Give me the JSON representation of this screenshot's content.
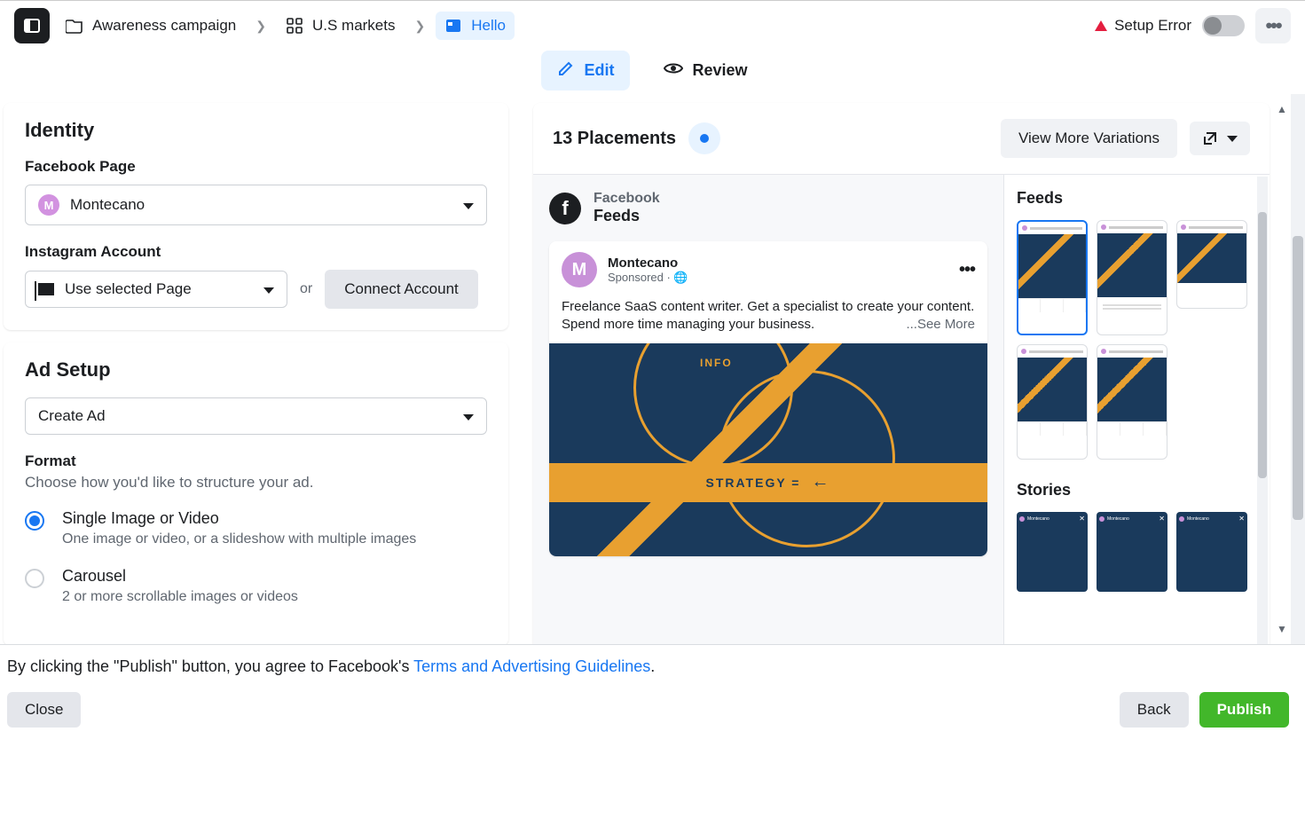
{
  "breadcrumb": {
    "campaign": "Awareness campaign",
    "adset": "U.S markets",
    "ad": "Hello"
  },
  "status": {
    "label": "Setup Error"
  },
  "tabs": {
    "edit": "Edit",
    "review": "Review"
  },
  "identity": {
    "heading": "Identity",
    "fb_label": "Facebook Page",
    "fb_value": "Montecano",
    "ig_label": "Instagram Account",
    "ig_value": "Use selected Page",
    "or": "or",
    "connect": "Connect Account"
  },
  "adsetup": {
    "heading": "Ad Setup",
    "select_value": "Create Ad",
    "format_label": "Format",
    "format_desc": "Choose how you'd like to structure your ad.",
    "opt1_title": "Single Image or Video",
    "opt1_desc": "One image or video, or a slideshow with multiple images",
    "opt2_title": "Carousel",
    "opt2_desc": "2 or more scrollable images or videos"
  },
  "preview": {
    "placements_title": "13 Placements",
    "variations_btn": "View More Variations",
    "network": "Facebook",
    "placement": "Feeds",
    "ad_page": "Montecano",
    "ad_sponsored": "Sponsored · 🌐",
    "ad_text": "Freelance SaaS content writer. Get a specialist to create your content. Spend more time managing your business.",
    "see_more": "...See More",
    "strategy": "STRATEGY =",
    "info": "INFO",
    "feeds_label": "Feeds",
    "stories_label": "Stories"
  },
  "footer": {
    "text_before": "By clicking the \"Publish\" button, you agree to Facebook's ",
    "link": "Terms and Advertising Guidelines",
    "text_after": ".",
    "close": "Close",
    "back": "Back",
    "publish": "Publish"
  }
}
